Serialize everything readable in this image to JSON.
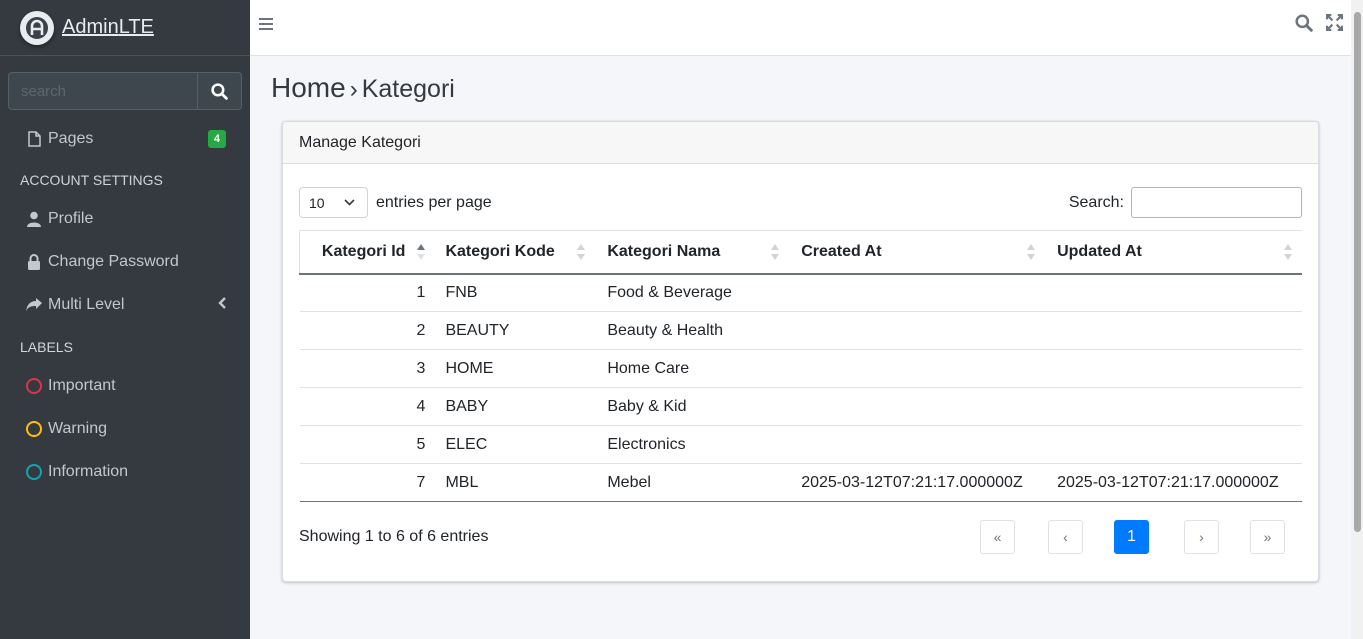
{
  "brand": {
    "name_bold": "Admin",
    "name_rest": "LTE"
  },
  "sidebar": {
    "search_placeholder": "search",
    "pages": {
      "label": "Pages",
      "badge": "4"
    },
    "account_header": "ACCOUNT SETTINGS",
    "profile": "Profile",
    "change_password": "Change Password",
    "multi_level": "Multi Level",
    "labels_header": "LABELS",
    "labels": [
      {
        "label": "Important",
        "color": "#dc3545"
      },
      {
        "label": "Warning",
        "color": "#ffc107"
      },
      {
        "label": "Information",
        "color": "#17a2b8"
      }
    ]
  },
  "breadcrumb": {
    "home": "Home",
    "separator": "›",
    "current": "Kategori"
  },
  "card": {
    "title": "Manage Kategori",
    "entries_value": "10",
    "entries_label": "entries per page",
    "search_label": "Search:",
    "columns": [
      "Kategori Id",
      "Kategori Kode",
      "Kategori Nama",
      "Created At",
      "Updated At"
    ],
    "rows": [
      [
        "1",
        "FNB",
        "Food & Beverage",
        "",
        ""
      ],
      [
        "2",
        "BEAUTY",
        "Beauty & Health",
        "",
        ""
      ],
      [
        "3",
        "HOME",
        "Home Care",
        "",
        ""
      ],
      [
        "4",
        "BABY",
        "Baby & Kid",
        "",
        ""
      ],
      [
        "5",
        "ELEC",
        "Electronics",
        "",
        ""
      ],
      [
        "7",
        "MBL",
        "Mebel",
        "2025-03-12T07:21:17.000000Z",
        "2025-03-12T07:21:17.000000Z"
      ]
    ],
    "info": "Showing 1 to 6 of 6 entries",
    "pagination": {
      "first": "«",
      "prev": "‹",
      "current": "1",
      "next": "›",
      "last": "»"
    }
  },
  "colors": {
    "sidebar_bg": "#343a40",
    "primary": "#007bff",
    "badge": "#28a745"
  }
}
